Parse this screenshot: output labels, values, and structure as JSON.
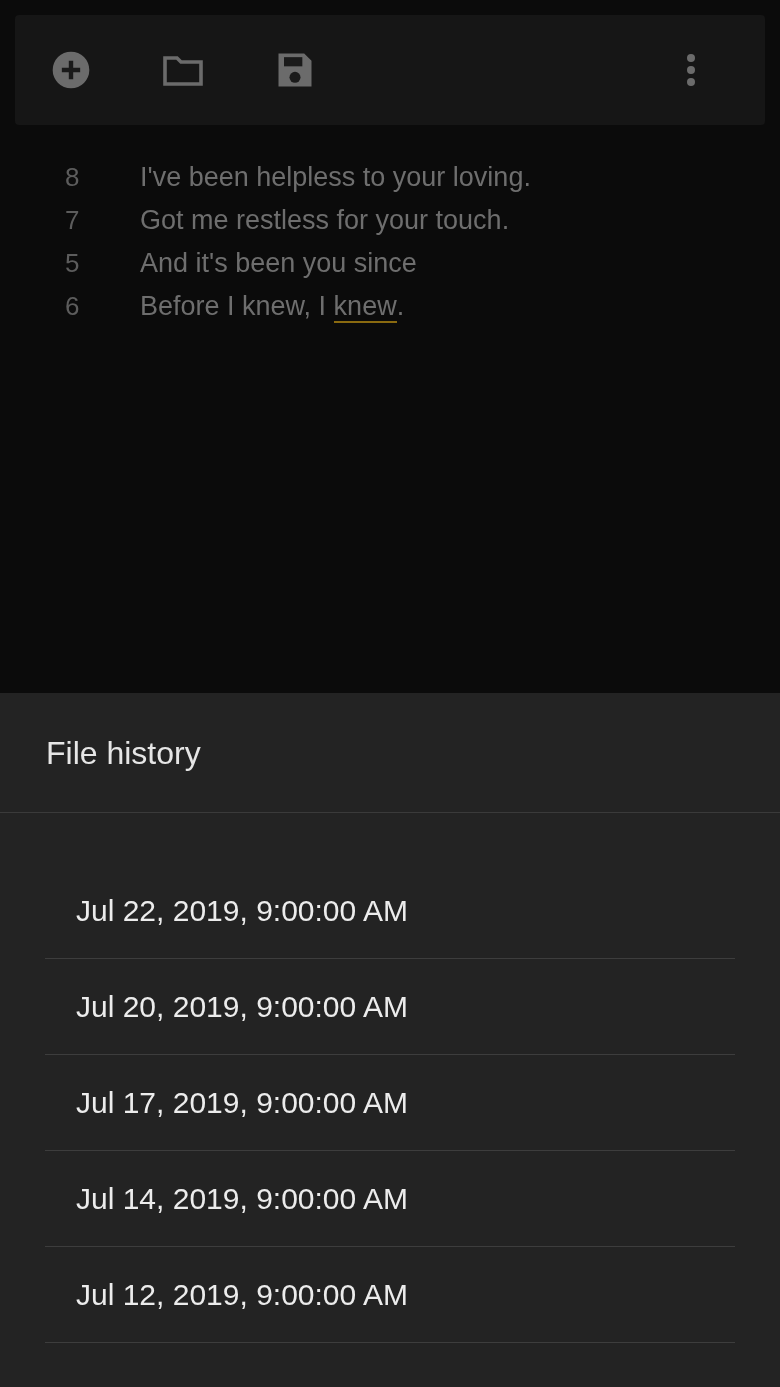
{
  "toolbar": {
    "buttons": [
      {
        "kind": "add"
      },
      {
        "kind": "open"
      },
      {
        "kind": "save"
      },
      {
        "kind": "more"
      }
    ]
  },
  "lyrics": [
    {
      "number": "8",
      "segments": [
        {
          "text": "I've been helpless to your loving.",
          "flagged": false
        }
      ]
    },
    {
      "number": "7",
      "segments": [
        {
          "text": "Got me restless for your touch.",
          "flagged": false
        }
      ]
    },
    {
      "number": "5",
      "segments": [
        {
          "text": "And it's been you since",
          "flagged": false
        }
      ]
    },
    {
      "number": "6",
      "segments": [
        {
          "text": "Before I knew, I ",
          "flagged": false
        },
        {
          "text": "knew",
          "flagged": true
        },
        {
          "text": ".",
          "flagged": false
        }
      ]
    }
  ],
  "sheet": {
    "title": "File history",
    "items": [
      "Jul 22, 2019, 9:00:00 AM",
      "Jul 20, 2019, 9:00:00 AM",
      "Jul 17, 2019, 9:00:00 AM",
      "Jul 14, 2019, 9:00:00 AM",
      "Jul 12, 2019, 9:00:00 AM"
    ]
  }
}
